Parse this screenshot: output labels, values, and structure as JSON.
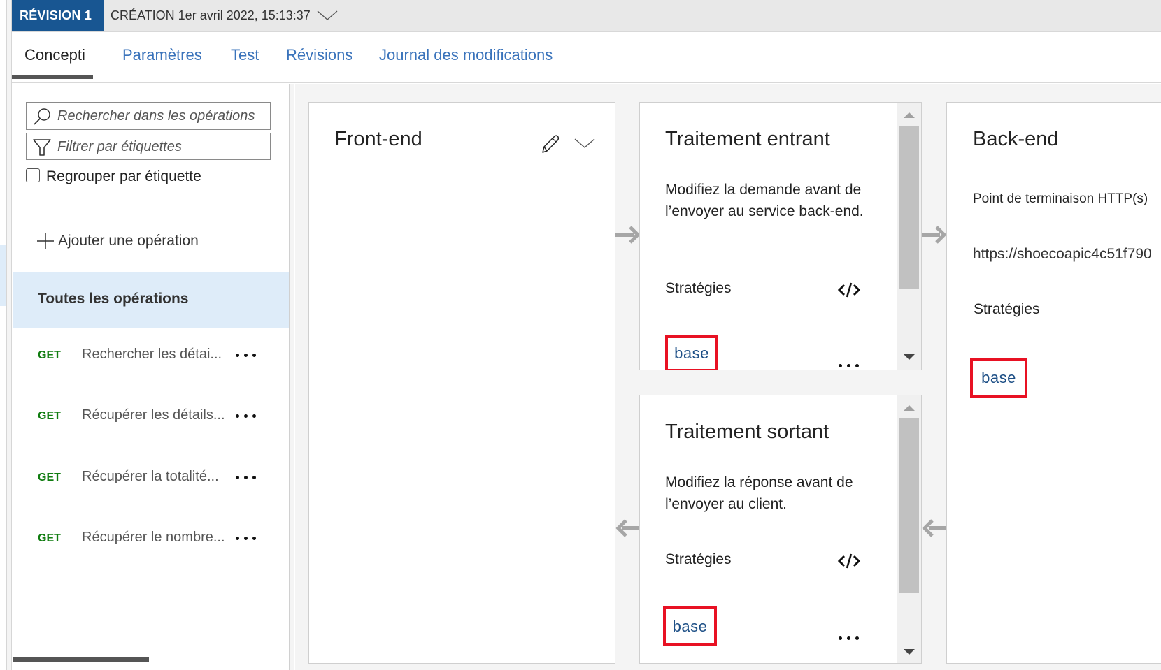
{
  "revision": {
    "badge": "RÉVISION 1",
    "created": "CRÉATION 1er avril 2022, 15:13:37",
    "chevron_icon": "chevron-down-icon"
  },
  "tabs": [
    {
      "label": "Concepti",
      "active": true
    },
    {
      "label": "Paramètres",
      "active": false
    },
    {
      "label": "Test",
      "active": false
    },
    {
      "label": "Révisions",
      "active": false
    },
    {
      "label": "Journal des modifications",
      "active": false
    }
  ],
  "sidebar": {
    "search_placeholder": "Rechercher dans les opérations",
    "filter_placeholder": "Filtrer par étiquettes",
    "group_by_tag_label": "Regrouper par étiquette",
    "group_by_tag_checked": false,
    "add_operation_label": "Ajouter une opération",
    "all_operations_label": "Toutes les opérations",
    "operations": [
      {
        "method": "GET",
        "name": "Rechercher les détai..."
      },
      {
        "method": "GET",
        "name": "Récupérer les détails..."
      },
      {
        "method": "GET",
        "name": "Récupérer la totalité..."
      },
      {
        "method": "GET",
        "name": "Récupérer le nombre..."
      }
    ]
  },
  "frontend": {
    "title": "Front-end",
    "edit_icon": "pencil-icon",
    "expand_icon": "chevron-down-icon"
  },
  "inbound": {
    "title": "Traitement entrant",
    "description": "Modifiez la demande avant de l’envoyer au service back-end.",
    "policies_label": "Stratégies",
    "policy_items": [
      "base"
    ],
    "code_icon": "code-editor-icon"
  },
  "outbound": {
    "title": "Traitement sortant",
    "description": "Modifiez la réponse avant de l’envoyer au client.",
    "policies_label": "Stratégies",
    "policy_items": [
      "base"
    ],
    "code_icon": "code-editor-icon"
  },
  "backend": {
    "title": "Back-end",
    "endpoint_label": "Point de terminaison HTTP(s)",
    "endpoint_url": "https://shoecoapic4c51f790",
    "policies_label": "Stratégies",
    "policy_items": [
      "base"
    ]
  },
  "colors": {
    "revision_badge": "#185692",
    "tab_link": "#3a73bb",
    "get_method": "#107c10",
    "selected_row": "#deecf9",
    "highlight_border": "#e81123",
    "base_link": "#1d4f86"
  }
}
